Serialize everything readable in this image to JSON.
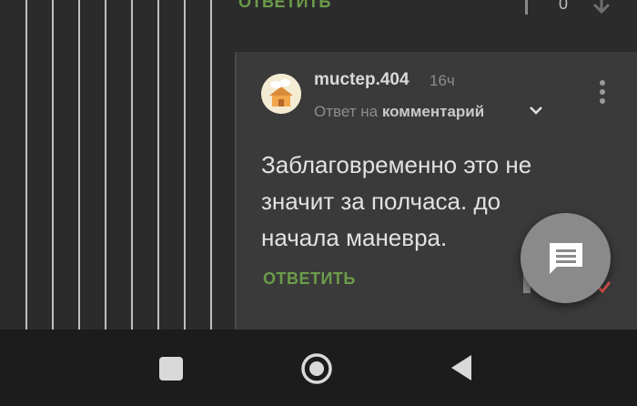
{
  "previous": {
    "reply_label": "ОТВЕТИТЬ",
    "score": "0"
  },
  "comment": {
    "author": "muctep.404",
    "time": "16ч",
    "reply_to_prefix": "Ответ на",
    "reply_to_target": "комментарий",
    "text": "Заблаговременно это не значит за полчаса. до начала маневра.",
    "reply_label": "ОТВЕТИТЬ"
  },
  "icons": {
    "fab": "comment-icon",
    "more": "more-vert-icon",
    "expand": "chevron-down-icon",
    "nav": [
      "recents-icon",
      "home-icon",
      "back-icon"
    ]
  },
  "colors": {
    "accent": "#6b9c4a",
    "surface": "#3a3a3a",
    "background": "#2b2b2b",
    "navbar": "#1c1c1c"
  }
}
